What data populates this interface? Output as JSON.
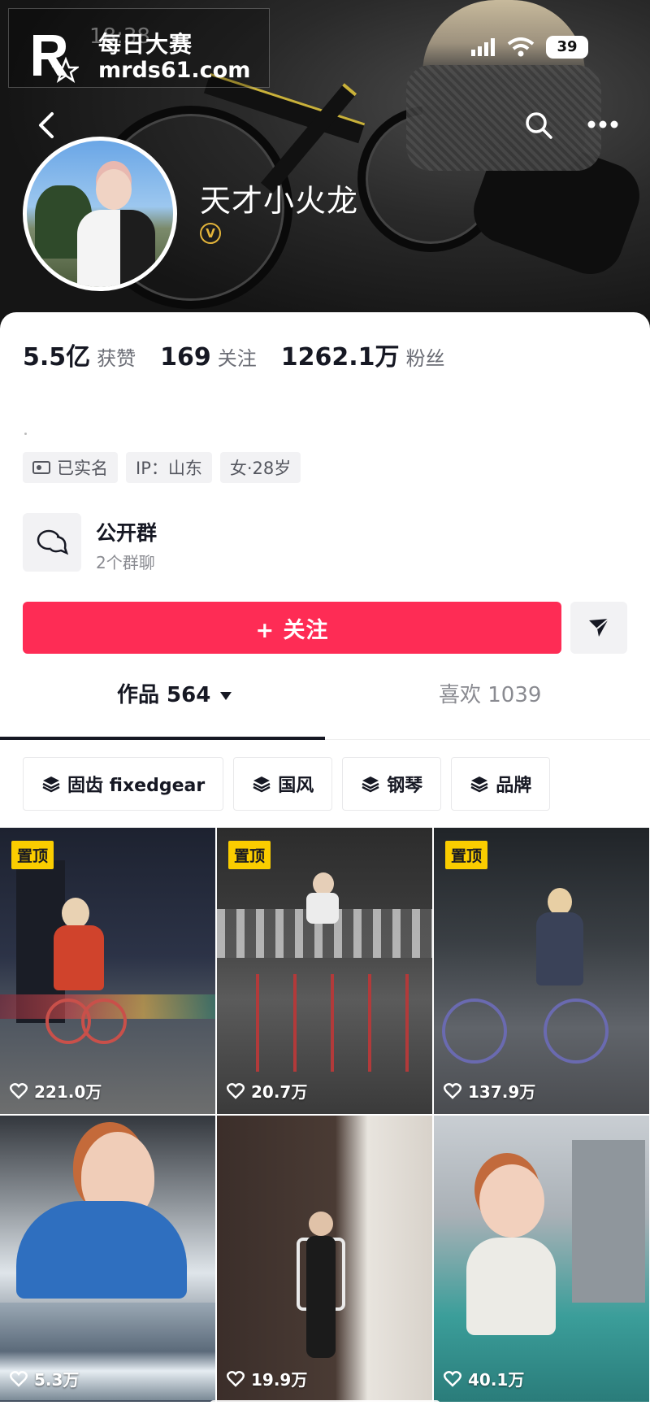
{
  "watermark": {
    "brand_title": "每日大赛",
    "site": "mrds61.com",
    "logo_small_text": "每日大赛"
  },
  "status_bar": {
    "time": "18:38",
    "battery": "39"
  },
  "profile": {
    "username": "天才小火龙",
    "verified_badge": "V",
    "stats": [
      {
        "value": "5.5亿",
        "label": "获赞"
      },
      {
        "value": "169",
        "label": "关注"
      },
      {
        "value": "1262.1万",
        "label": "粉丝"
      }
    ],
    "tags": [
      {
        "text": "已实名",
        "icon": "id-card-icon"
      },
      {
        "text": "IP：山东"
      },
      {
        "text": "女·28岁"
      }
    ]
  },
  "group": {
    "title": "公开群",
    "subtitle": "2个群聊"
  },
  "actions": {
    "follow_label": "+ 关注"
  },
  "tabs": [
    {
      "label": "作品 564",
      "active": true
    },
    {
      "label": "喜欢 1039",
      "active": false
    }
  ],
  "collections": [
    {
      "label": "固齿 fixedgear"
    },
    {
      "label": "国风"
    },
    {
      "label": "钢琴"
    },
    {
      "label": "品牌"
    }
  ],
  "videos": [
    {
      "pinned": true,
      "pin_label": "置顶",
      "likes": "221.0万"
    },
    {
      "pinned": true,
      "pin_label": "置顶",
      "likes": "20.7万"
    },
    {
      "pinned": true,
      "pin_label": "置顶",
      "likes": "137.9万"
    },
    {
      "pinned": false,
      "likes": "5.3万"
    },
    {
      "pinned": false,
      "likes": "19.9万"
    },
    {
      "pinned": false,
      "likes": "40.1万"
    }
  ],
  "colors": {
    "accent": "#fe2c55",
    "pin_bg": "#facd00",
    "verified": "#e3b43a"
  }
}
